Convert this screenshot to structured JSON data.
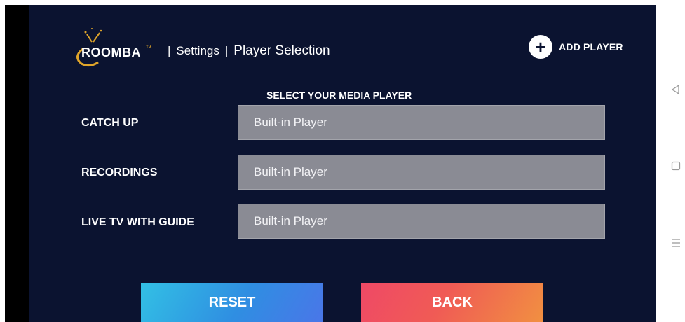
{
  "app": {
    "logo_text": "ROOMBA",
    "logo_superscript": "TV"
  },
  "breadcrumb": {
    "separator": "|",
    "settings": "Settings",
    "current": "Player Selection"
  },
  "header": {
    "add_player_icon": "+",
    "add_player_label": "ADD PLAYER"
  },
  "main": {
    "heading": "SELECT YOUR MEDIA PLAYER",
    "rows": [
      {
        "label": "CATCH UP",
        "value": "Built-in Player"
      },
      {
        "label": "RECORDINGS",
        "value": "Built-in Player"
      },
      {
        "label": "LIVE TV WITH GUIDE",
        "value": "Built-in Player"
      }
    ]
  },
  "buttons": {
    "reset": "RESET",
    "back": "BACK"
  },
  "system_nav": {
    "icons": [
      "back-triangle-icon",
      "home-square-icon",
      "menu-lines-icon"
    ]
  },
  "colors": {
    "background": "#0b1330",
    "field": "#8a8b94",
    "logo_accent": "#e0a52a",
    "reset_gradient": [
      "#32c0e4",
      "#4a76e8"
    ],
    "back_gradient": [
      "#ef4966",
      "#f19041"
    ]
  }
}
